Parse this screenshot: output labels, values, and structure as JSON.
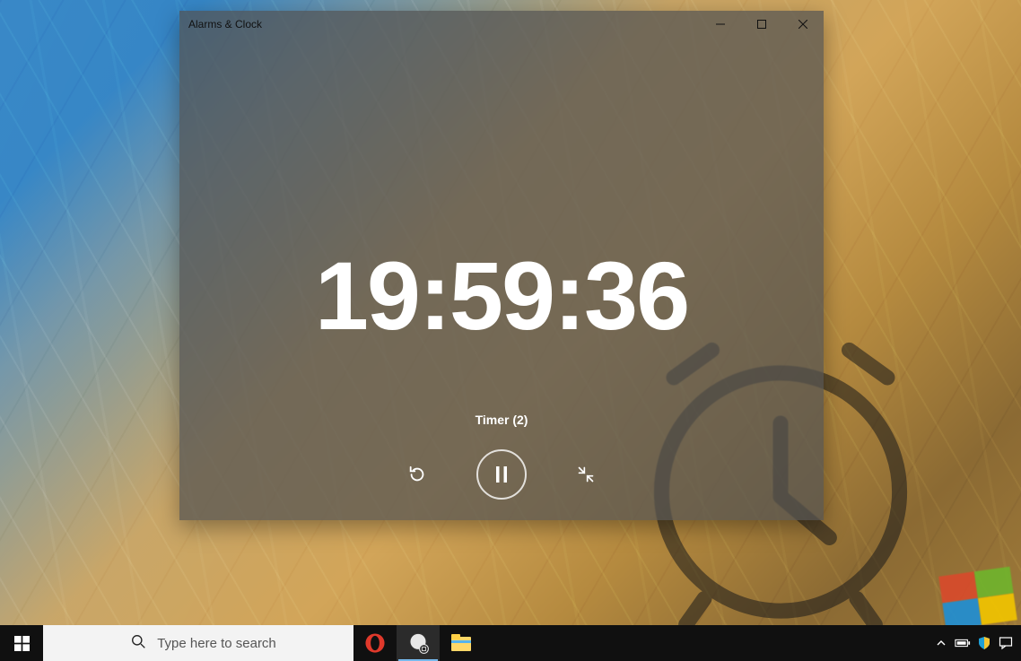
{
  "window": {
    "title": "Alarms & Clock",
    "timer_value": "19:59:36",
    "timer_label": "Timer (2)"
  },
  "taskbar": {
    "search_placeholder": "Type here to search"
  },
  "icons": {
    "minimize": "minimize",
    "maximize": "maximize",
    "close": "close",
    "reset": "reset",
    "pause": "pause",
    "collapse": "collapse"
  },
  "colors": {
    "window_bg": "rgba(82,82,82,0.72)",
    "timer_text": "#ffffff",
    "taskbar_bg": "#101010",
    "search_bg": "#f3f3f3"
  }
}
